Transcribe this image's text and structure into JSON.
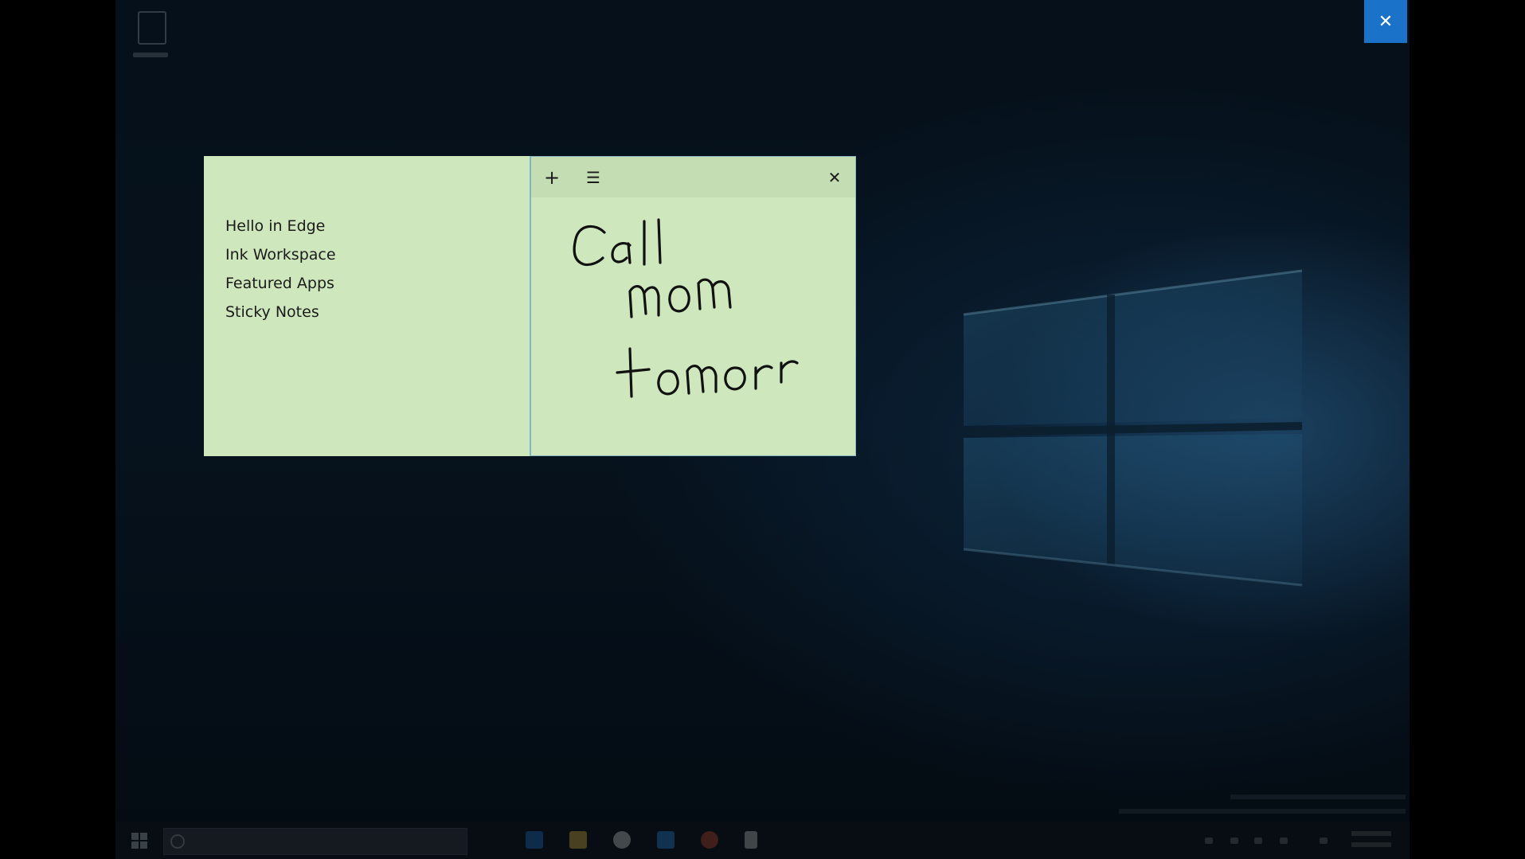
{
  "overlay": {
    "close_icon": "close-icon",
    "close_glyph": "✕",
    "accent": "#1a73c9"
  },
  "notes_list": {
    "items": [
      {
        "label": "Hello in Edge"
      },
      {
        "label": "Ink Workspace"
      },
      {
        "label": "Featured Apps"
      },
      {
        "label": "Sticky Notes"
      }
    ],
    "background": "#cfe7bd"
  },
  "note": {
    "toolbar": {
      "add_glyph": "+",
      "menu_glyph": "☰",
      "close_glyph": "✕",
      "add_icon": "plus-icon",
      "menu_icon": "hamburger-menu-icon",
      "close_icon": "close-icon"
    },
    "handwriting": [
      "Call",
      "mom",
      "tomorr"
    ],
    "ink_color": "#111111",
    "toolbar_color": "#c4ddb2"
  },
  "desktop": {
    "wallpaper": "windows-10-logo",
    "icons": [
      "recycle-bin-icon"
    ]
  }
}
